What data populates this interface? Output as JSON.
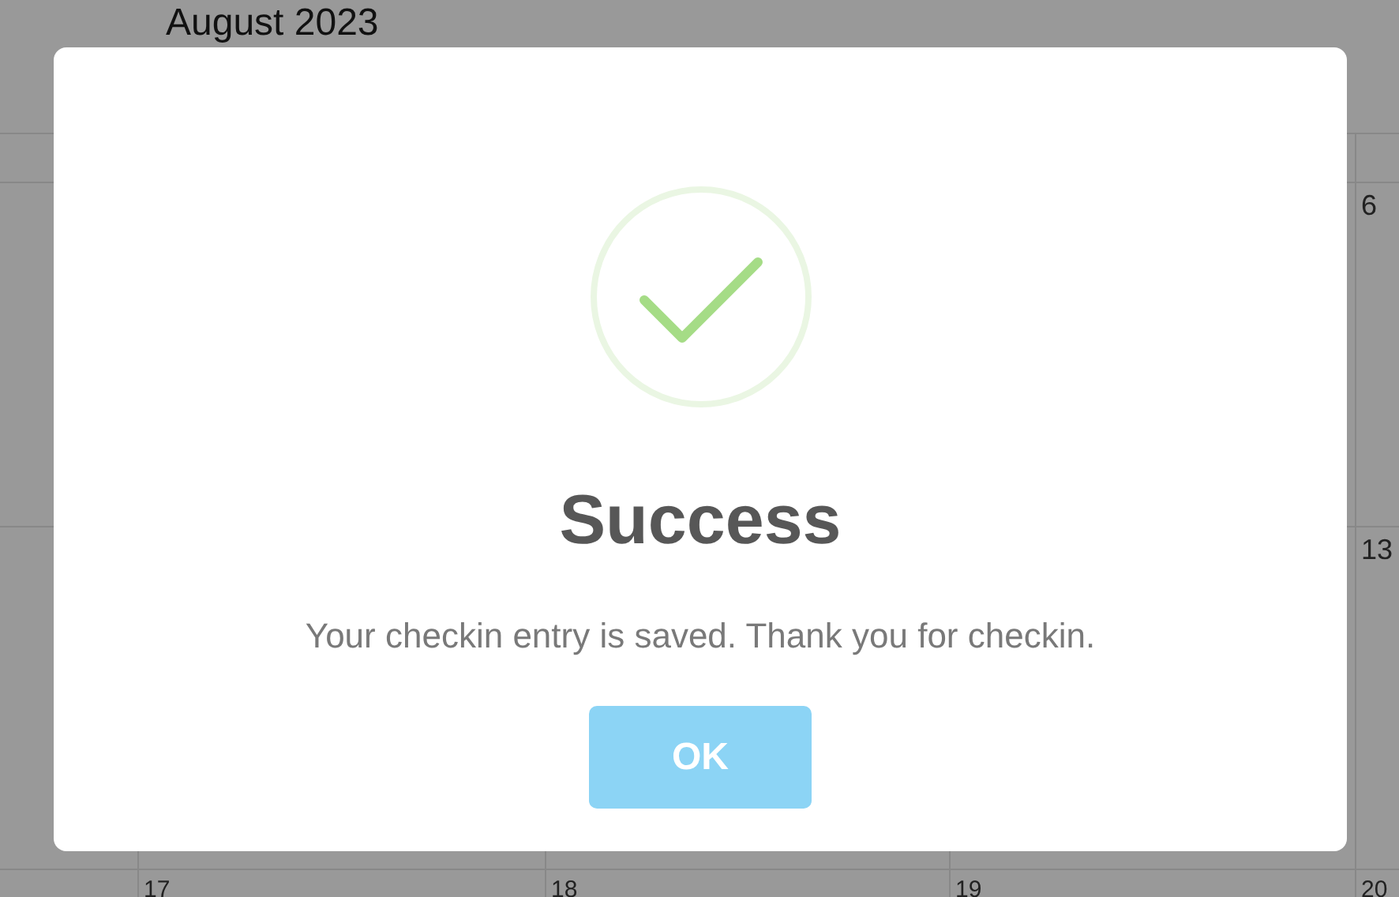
{
  "calendar": {
    "title": "August 2023",
    "weeks": [
      [
        {
          "day": "6"
        }
      ],
      [
        {
          "day": "13"
        }
      ],
      [
        {
          "day": "17"
        },
        {
          "day": "18"
        },
        {
          "day": "19"
        },
        {
          "day": "20"
        }
      ]
    ]
  },
  "dialog": {
    "title": "Success",
    "message": "Your checkin entry is saved. Thank you for checkin.",
    "button": "OK"
  }
}
